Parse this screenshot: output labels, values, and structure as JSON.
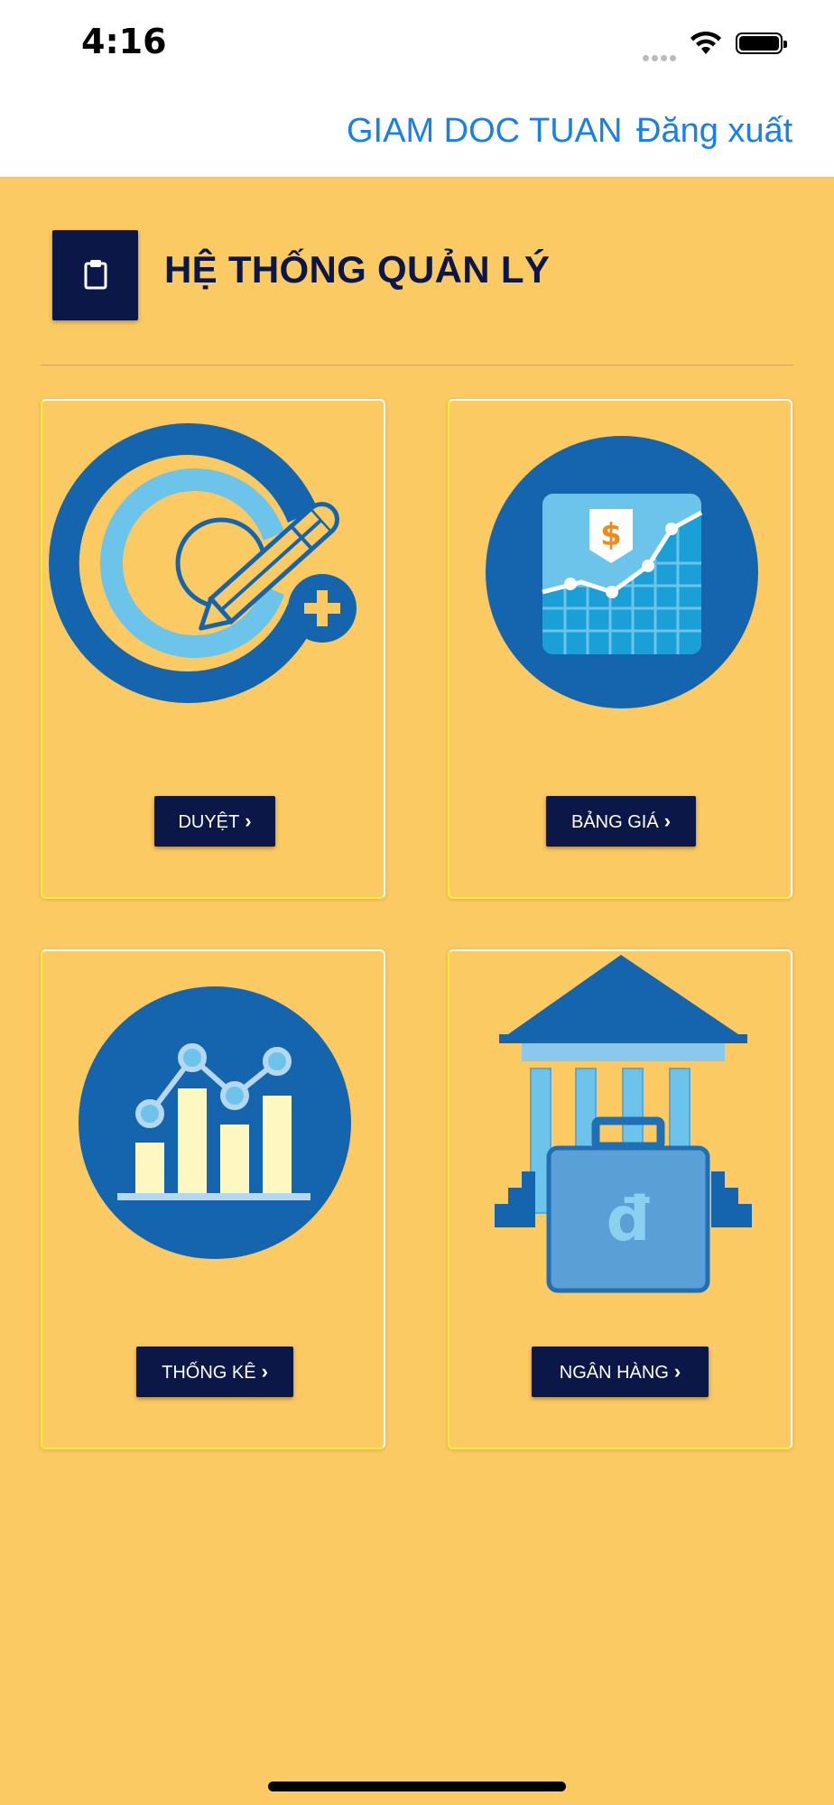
{
  "status_bar": {
    "time": "4:16"
  },
  "nav": {
    "user_name": "GIAM DOC TUAN",
    "logout_label": "Đăng xuất"
  },
  "header": {
    "title": "HỆ THỐNG QUẢN LÝ",
    "icon": "clipboard-icon"
  },
  "cards": [
    {
      "label": "DUYỆT",
      "icon": "approve-edit-icon"
    },
    {
      "label": "BẢNG GIÁ",
      "icon": "price-chart-icon"
    },
    {
      "label": "THỐNG KÊ",
      "icon": "statistics-icon"
    },
    {
      "label": "NGÂN HÀNG",
      "icon": "bank-icon"
    }
  ],
  "colors": {
    "background": "#FCCA63",
    "navy": "#0B1747",
    "link_blue": "#1A7FE6",
    "icon_blue": "#1565AE"
  }
}
